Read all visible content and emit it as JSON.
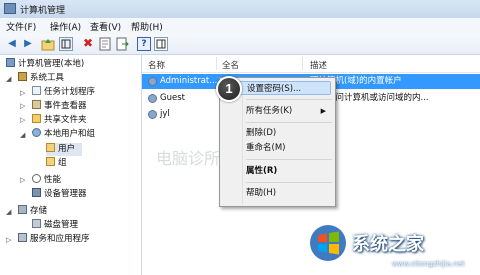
{
  "window": {
    "title": "计算机管理"
  },
  "menu": [
    "文件(F)",
    "操作(A)",
    "查看(V)",
    "帮助(H)"
  ],
  "toolbar": {
    "buttons": [
      "back-icon",
      "forward-icon",
      "up-icon",
      "console-tree-icon",
      "delete-icon",
      "properties-icon",
      "export-icon",
      "help-icon",
      "show-pane-icon"
    ]
  },
  "tree": {
    "root": "计算机管理(本地)",
    "system_tools": "系统工具",
    "task_scheduler": "任务计划程序",
    "event_viewer": "事件查看器",
    "shared_folders": "共享文件夹",
    "local_users_groups": "本地用户和组",
    "users": "用户",
    "groups": "组",
    "performance": "性能",
    "device_manager": "设备管理器",
    "storage": "存储",
    "disk_management": "磁盘管理",
    "services_apps": "服务和应用程序"
  },
  "list": {
    "columns": [
      "名称",
      "全名",
      "描述"
    ],
    "rows": [
      {
        "name": "Administrat...",
        "fullname": "",
        "description": "理计算机(域)的内置帐户"
      },
      {
        "name": "Guest",
        "fullname": "",
        "description": "来宾访问计算机或访问域的内..."
      },
      {
        "name": "jyl",
        "fullname": "",
        "description": ""
      }
    ]
  },
  "context_menu": {
    "set_password": "设置密码(S)...",
    "all_tasks": "所有任务(K)",
    "delete": "删除(D)",
    "rename": "重命名(M)",
    "properties": "属性(R)",
    "help": "帮助(H)"
  },
  "badge": "1",
  "watermark": {
    "center": "电脑诊所",
    "brand": "系统之家",
    "url": "www.xitongzhijia.net"
  },
  "colors": {
    "selection": "#3399ff",
    "menu_highlight": "#cfe3fa",
    "title_bar": "#d2e1f3"
  }
}
